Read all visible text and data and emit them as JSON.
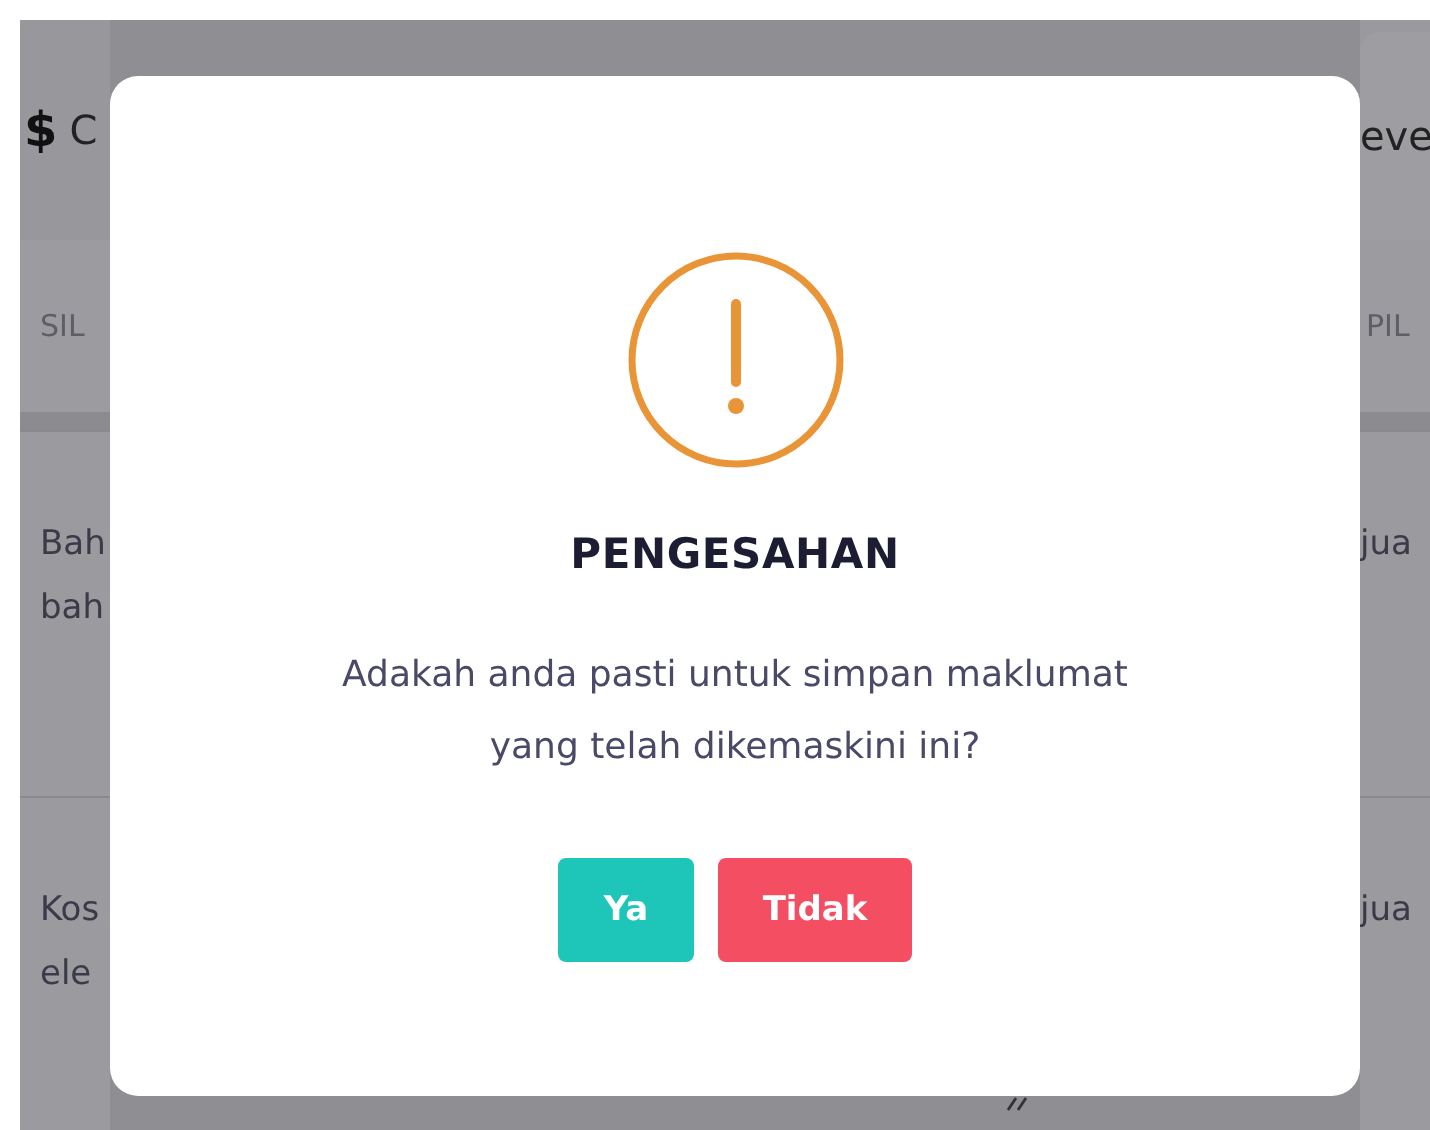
{
  "background": {
    "header": {
      "symbol": "$",
      "left_text": "C",
      "right_text": "eve"
    },
    "table": {
      "columns": [
        "SIL",
        "PIL"
      ],
      "rows": [
        {
          "column_1": [
            "Bah",
            "bah"
          ],
          "column_2": "jua"
        },
        {
          "column_1": [
            "Kos",
            "ele"
          ],
          "column_2": "jua"
        }
      ]
    }
  },
  "dialog": {
    "kind": "warning",
    "title": "PENGESAHAN",
    "message": [
      "Adakah anda pasti untuk simpan maklumat",
      "yang telah dikemaskini ini?"
    ],
    "buttons": [
      {
        "label": "Ya",
        "kind": "confirm"
      },
      {
        "label": "Tidak",
        "kind": "cancel"
      }
    ]
  }
}
